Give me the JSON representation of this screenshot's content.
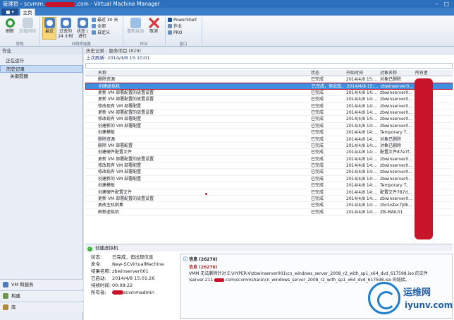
{
  "window": {
    "title_prefix": "管理员 - scvmm.",
    "title_suffix": ".com - Virtual Machine Manager",
    "controls": "– □ ✕"
  },
  "file_button": "■ ▾",
  "tabs": [
    {
      "label": "主页"
    }
  ],
  "ribbon": {
    "refresh": "刷新",
    "add_host": "加载网络",
    "group_label_home": "常规",
    "recent": "最近",
    "last24": "过去的 24 小时",
    "running": "状态 \\ 进行",
    "last30": "最近 30 天",
    "all": "全部",
    "custom": "自定义",
    "group_label_filter": "日期筛选器",
    "restart": "重新启动",
    "cancel": "取消",
    "group_label_job": "作业",
    "powershell": "PowerShell",
    "jobs": "作业",
    "pro": "PRO",
    "group_label_window": "窗口"
  },
  "leftnav": {
    "header": "作业",
    "items": [
      {
        "label": "正在运行"
      },
      {
        "label": "历史记录"
      },
      {
        "label": "关键提醒"
      }
    ],
    "bottom": [
      {
        "label": "VM 和服务"
      },
      {
        "label": "构建"
      },
      {
        "label": "库"
      }
    ]
  },
  "main": {
    "header": "历史记录 - 服务项目 (829)",
    "last_refresh": "上次刷新: 2014/4/8 15:10:01"
  },
  "grid": {
    "columns": [
      "名称",
      "状态",
      "开始时间",
      "对象名称",
      "所有者"
    ],
    "rows": [
      {
        "name": "删除资源",
        "status": "已完成",
        "start": "2014/4/8 15:...",
        "object": "对象已删除"
      },
      {
        "name": "创建虚拟机",
        "status": "已完成，但出现...",
        "start": "2014/4/8 15:...",
        "object": "zbwinserver0...",
        "selected": true
      },
      {
        "name": "更新 VM 部署配置的放置设置",
        "status": "已完成",
        "start": "2014/4/8 14:...",
        "object": "zbwinserver0..."
      },
      {
        "name": "更新 VM 部署配置的放置设置",
        "status": "已完成",
        "start": "2014/4/8 14:...",
        "object": "zbwinserver0..."
      },
      {
        "name": "修改现有 VM 部署配置",
        "status": "已完成",
        "start": "2014/4/8 14:...",
        "object": "zbwinserver0..."
      },
      {
        "name": "更新 VM 部署配置的放置设置",
        "status": "已完成",
        "start": "2014/4/8 14:...",
        "object": "zbwinserver0..."
      },
      {
        "name": "修改现有 VM 部署配置",
        "status": "已完成",
        "start": "2014/4/8 14:...",
        "object": "zbwinserver0..."
      },
      {
        "name": "创建新的 VM 部署配置",
        "status": "已完成",
        "start": "2014/4/8 14:...",
        "object": "zbwinserver0..."
      },
      {
        "name": "创建模板",
        "status": "已完成",
        "start": "2014/4/8 14:...",
        "object": "Temporary T..."
      },
      {
        "name": "删除资源",
        "status": "已完成",
        "start": "2014/4/8 14:...",
        "object": "对象已删除"
      },
      {
        "name": "删除 VM 部署配置",
        "status": "已完成",
        "start": "2014/4/8 14:...",
        "object": "对象已删除"
      },
      {
        "name": "创建硬件配置文件",
        "status": "已完成",
        "start": "2014/4/8 14:...",
        "object": "配置文件87e7f..."
      },
      {
        "name": "更新 VM 部署配置的放置设置",
        "status": "已完成",
        "start": "2014/4/8 14:...",
        "object": "zbwinserver0..."
      },
      {
        "name": "修改现有 VM 部署配置",
        "status": "已完成",
        "start": "2014/4/8 14:...",
        "object": "zbwinserver0..."
      },
      {
        "name": "修改现有 VM 部署配置",
        "status": "已完成",
        "start": "2014/4/8 14:...",
        "object": "zbwinserver0..."
      },
      {
        "name": "创建新的 VM 部署配置",
        "status": "已完成",
        "start": "2014/4/8 14:...",
        "object": "zbwinserver0..."
      },
      {
        "name": "创建模板",
        "status": "已完成",
        "start": "2014/4/8 14:...",
        "object": "Temporary T..."
      },
      {
        "name": "创建硬件配置文件",
        "status": "已完成",
        "start": "2014/4/8 14:...",
        "object": "配置文件787d..."
      },
      {
        "name": "更新 VM 部署配置的放置设置",
        "status": "已完成",
        "start": "2014/4/8 14:...",
        "object": "zbwinserver0..."
      },
      {
        "name": "更改主机群集",
        "status": "已完成",
        "start": "2014/4/8 14:...",
        "object": "zbcluster.fjdb..."
      },
      {
        "name": "刷新虚拟机",
        "status": "已完成",
        "start": "2014/4/8 14:...",
        "object": "ZB-MAIL01"
      }
    ]
  },
  "detail": {
    "title": "创建虚拟机",
    "fields": [
      {
        "k": "状态:",
        "v": "已完成，但出现信息"
      },
      {
        "k": "命令:",
        "v": "New-SCVirtualMachine"
      },
      {
        "k": "结果名称:",
        "v": "zbwinserver001"
      },
      {
        "k": "已启动:",
        "v": "2014/4/8 15:01:26"
      },
      {
        "k": "持续时间:",
        "v": "00:08:22"
      },
      {
        "k": "所有者:",
        "v": "scvmmadmin"
      }
    ],
    "info_header": "信息 (26276)",
    "info_code": "信息 (26276)",
    "info_line1": "VMM 无法删除针对 E:\\HYPER-V\\zbwinserver001\\cn_windows_server_2008_r2_with_sp1_x64_dvd_617598.iso 的文件",
    "info_line2": "\\server-211.",
    "info_line2b": ".com\\scvmmshare\\cn_windows_server_2008_r2_with_sp1_x64_dvd_617598.iso 的链接。"
  },
  "watermark": {
    "cn": "运维网",
    "en": "iyunv.com"
  },
  "colors": {
    "title": "#2c6fbd",
    "selection": "#3f8ee0",
    "redact": "#c8142a",
    "ok": "#3fae3a"
  }
}
